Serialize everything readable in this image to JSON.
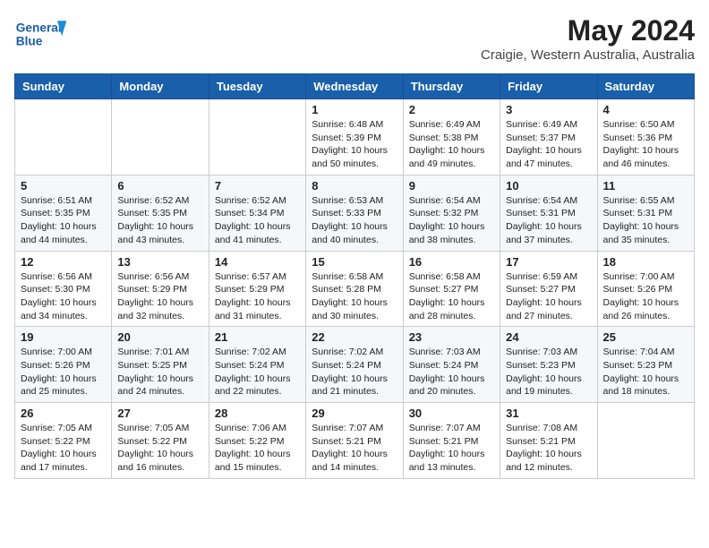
{
  "header": {
    "logo_line1": "General",
    "logo_line2": "Blue",
    "title": "May 2024",
    "subtitle": "Craigie, Western Australia, Australia"
  },
  "weekdays": [
    "Sunday",
    "Monday",
    "Tuesday",
    "Wednesday",
    "Thursday",
    "Friday",
    "Saturday"
  ],
  "weeks": [
    [
      {
        "day": "",
        "info": ""
      },
      {
        "day": "",
        "info": ""
      },
      {
        "day": "",
        "info": ""
      },
      {
        "day": "1",
        "info": "Sunrise: 6:48 AM\nSunset: 5:39 PM\nDaylight: 10 hours\nand 50 minutes."
      },
      {
        "day": "2",
        "info": "Sunrise: 6:49 AM\nSunset: 5:38 PM\nDaylight: 10 hours\nand 49 minutes."
      },
      {
        "day": "3",
        "info": "Sunrise: 6:49 AM\nSunset: 5:37 PM\nDaylight: 10 hours\nand 47 minutes."
      },
      {
        "day": "4",
        "info": "Sunrise: 6:50 AM\nSunset: 5:36 PM\nDaylight: 10 hours\nand 46 minutes."
      }
    ],
    [
      {
        "day": "5",
        "info": "Sunrise: 6:51 AM\nSunset: 5:35 PM\nDaylight: 10 hours\nand 44 minutes."
      },
      {
        "day": "6",
        "info": "Sunrise: 6:52 AM\nSunset: 5:35 PM\nDaylight: 10 hours\nand 43 minutes."
      },
      {
        "day": "7",
        "info": "Sunrise: 6:52 AM\nSunset: 5:34 PM\nDaylight: 10 hours\nand 41 minutes."
      },
      {
        "day": "8",
        "info": "Sunrise: 6:53 AM\nSunset: 5:33 PM\nDaylight: 10 hours\nand 40 minutes."
      },
      {
        "day": "9",
        "info": "Sunrise: 6:54 AM\nSunset: 5:32 PM\nDaylight: 10 hours\nand 38 minutes."
      },
      {
        "day": "10",
        "info": "Sunrise: 6:54 AM\nSunset: 5:31 PM\nDaylight: 10 hours\nand 37 minutes."
      },
      {
        "day": "11",
        "info": "Sunrise: 6:55 AM\nSunset: 5:31 PM\nDaylight: 10 hours\nand 35 minutes."
      }
    ],
    [
      {
        "day": "12",
        "info": "Sunrise: 6:56 AM\nSunset: 5:30 PM\nDaylight: 10 hours\nand 34 minutes."
      },
      {
        "day": "13",
        "info": "Sunrise: 6:56 AM\nSunset: 5:29 PM\nDaylight: 10 hours\nand 32 minutes."
      },
      {
        "day": "14",
        "info": "Sunrise: 6:57 AM\nSunset: 5:29 PM\nDaylight: 10 hours\nand 31 minutes."
      },
      {
        "day": "15",
        "info": "Sunrise: 6:58 AM\nSunset: 5:28 PM\nDaylight: 10 hours\nand 30 minutes."
      },
      {
        "day": "16",
        "info": "Sunrise: 6:58 AM\nSunset: 5:27 PM\nDaylight: 10 hours\nand 28 minutes."
      },
      {
        "day": "17",
        "info": "Sunrise: 6:59 AM\nSunset: 5:27 PM\nDaylight: 10 hours\nand 27 minutes."
      },
      {
        "day": "18",
        "info": "Sunrise: 7:00 AM\nSunset: 5:26 PM\nDaylight: 10 hours\nand 26 minutes."
      }
    ],
    [
      {
        "day": "19",
        "info": "Sunrise: 7:00 AM\nSunset: 5:26 PM\nDaylight: 10 hours\nand 25 minutes."
      },
      {
        "day": "20",
        "info": "Sunrise: 7:01 AM\nSunset: 5:25 PM\nDaylight: 10 hours\nand 24 minutes."
      },
      {
        "day": "21",
        "info": "Sunrise: 7:02 AM\nSunset: 5:24 PM\nDaylight: 10 hours\nand 22 minutes."
      },
      {
        "day": "22",
        "info": "Sunrise: 7:02 AM\nSunset: 5:24 PM\nDaylight: 10 hours\nand 21 minutes."
      },
      {
        "day": "23",
        "info": "Sunrise: 7:03 AM\nSunset: 5:24 PM\nDaylight: 10 hours\nand 20 minutes."
      },
      {
        "day": "24",
        "info": "Sunrise: 7:03 AM\nSunset: 5:23 PM\nDaylight: 10 hours\nand 19 minutes."
      },
      {
        "day": "25",
        "info": "Sunrise: 7:04 AM\nSunset: 5:23 PM\nDaylight: 10 hours\nand 18 minutes."
      }
    ],
    [
      {
        "day": "26",
        "info": "Sunrise: 7:05 AM\nSunset: 5:22 PM\nDaylight: 10 hours\nand 17 minutes."
      },
      {
        "day": "27",
        "info": "Sunrise: 7:05 AM\nSunset: 5:22 PM\nDaylight: 10 hours\nand 16 minutes."
      },
      {
        "day": "28",
        "info": "Sunrise: 7:06 AM\nSunset: 5:22 PM\nDaylight: 10 hours\nand 15 minutes."
      },
      {
        "day": "29",
        "info": "Sunrise: 7:07 AM\nSunset: 5:21 PM\nDaylight: 10 hours\nand 14 minutes."
      },
      {
        "day": "30",
        "info": "Sunrise: 7:07 AM\nSunset: 5:21 PM\nDaylight: 10 hours\nand 13 minutes."
      },
      {
        "day": "31",
        "info": "Sunrise: 7:08 AM\nSunset: 5:21 PM\nDaylight: 10 hours\nand 12 minutes."
      },
      {
        "day": "",
        "info": ""
      }
    ]
  ]
}
